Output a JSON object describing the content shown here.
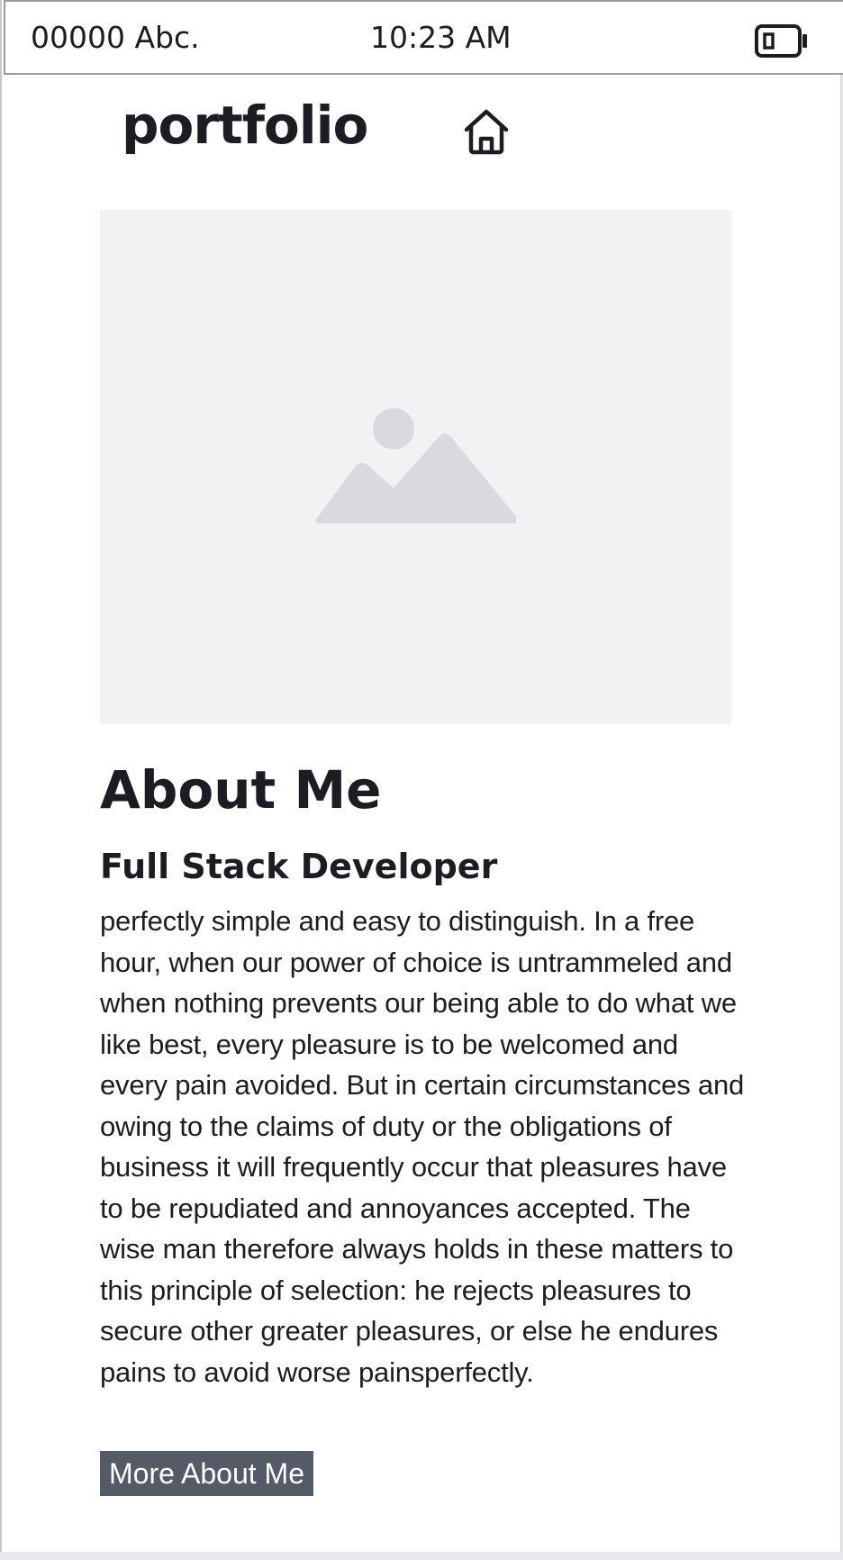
{
  "status_bar": {
    "carrier": "00000 Abc.",
    "time": "10:23 AM",
    "battery_icon": "battery-icon"
  },
  "header": {
    "brand": "portfolio",
    "home_icon": "home-icon"
  },
  "hero": {
    "image_icon": "image-placeholder-icon"
  },
  "about": {
    "title": "About Me",
    "role": "Full Stack Developer",
    "bio": "perfectly simple and easy to distinguish. In a free hour, when our power of choice is untrammeled and when nothing prevents our being able to do what we like best, every pleasure is to be welcomed and every pain avoided. But in certain circumstances and owing to the claims of duty or the obligations of business it will frequently occur that pleasures have to be repudiated and annoyances accepted. The wise man therefore always holds in these matters to this principle of selection: he rejects pleasures to secure other greater pleasures, or else he endures pains to avoid worse painsperfectly.",
    "button_label": "More About Me"
  },
  "colors": {
    "text": "#1c1d22",
    "button_bg": "#555b66",
    "placeholder_bg": "#f2f2f4",
    "placeholder_icon": "#d9dadd"
  }
}
